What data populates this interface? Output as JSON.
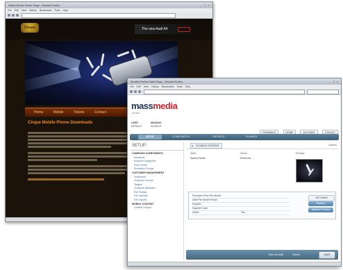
{
  "back_window": {
    "title": "Nokia Series Home Page - Mozilla Firefox",
    "menu": "File Edit View History Bookmarks Tools Help",
    "logo": "Cirque",
    "ad_text": "The new Audi A4",
    "nav": [
      "Home",
      "Mobile",
      "Tickets",
      "Contact"
    ],
    "heading": "Cirque Mobile Phone Downloads",
    "link_text": "Cirque"
  },
  "front_window": {
    "title": "Mozilla Firefox Start Page - Mozilla Firefox",
    "menu": "File Edit View History Bookmarks Tools Help",
    "logo_prefix": "mass",
    "logo_suffix": "media",
    "logo_sub": "STUDIO",
    "user": {
      "col1": [
        "USER",
        "DEFAULT"
      ],
      "col2": [
        "MANAGE",
        "SIGNOUT"
      ]
    },
    "top_buttons": [
      "FEEDBACK",
      "HOME",
      "ACCOUNT",
      "LOGOUT"
    ],
    "tabs": [
      "SETUP",
      "COMPONENTS",
      "REPORTS",
      "PLANNER"
    ],
    "sidebar": {
      "title": "SETUP",
      "sections": [
        {
          "heading": "CAMPAIGN COMPONENTS",
          "items": [
            "Keywords",
            "Keyword Categories",
            "Price Points",
            "Promotion Groups"
          ]
        },
        {
          "heading": "CUSTOMER MANAGEMENT",
          "items": [
            "Customers",
            "Customer Groups",
            "Targets",
            "Customer Attributes",
            "File Profiles",
            "File Uploads",
            "File Imports"
          ]
        },
        {
          "heading": "MOBILE CONTENT",
          "items": [
            "Content Groups"
          ]
        }
      ]
    },
    "main": {
      "go_back": "GO BACK CONTENT",
      "icons_label": "Options",
      "fields": [
        {
          "label": "Artist",
          "value": "System Name"
        },
        {
          "label": "Genre",
          "value": "Performer"
        },
        {
          "label": "Preview",
          "value": ""
        }
      ],
      "subtabs": [
        "General",
        "Categories",
        "Phone Support"
      ],
      "rows": [
        {
          "label": "Purchase Price Per Month",
          "value": ""
        },
        {
          "label": "Date Per Month Period",
          "value": ""
        },
        {
          "label": "Supplier",
          "value": ""
        },
        {
          "label": "Supplier Code",
          "value": ""
        },
        {
          "label": "Active",
          "value": "Yes"
        }
      ],
      "right_buttons": [
        "All Content",
        "Replace",
        "Replace Preview"
      ],
      "bottom_buttons": [
        "Save as Draft",
        "Cancel"
      ],
      "save_button": "SAVE"
    }
  }
}
